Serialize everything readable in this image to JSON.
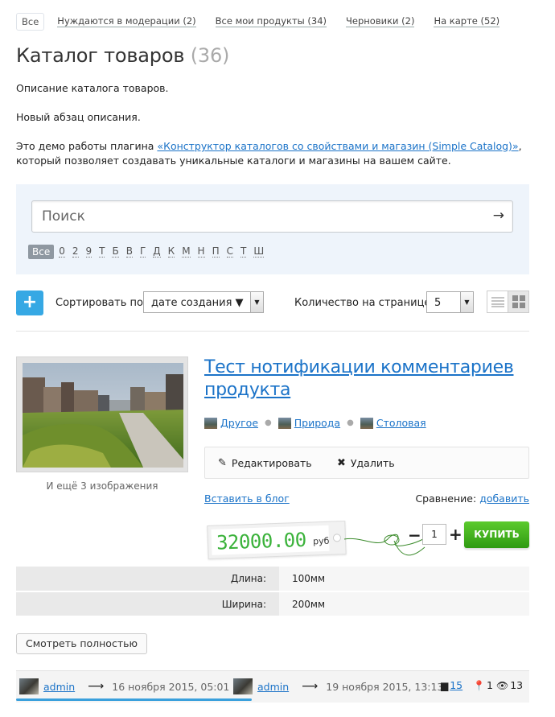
{
  "filters": {
    "all": "Все",
    "items": [
      "Нуждаются в модерации (2)",
      "Все мои продукты (34)",
      "Черновики (2)",
      "На карте (52)"
    ]
  },
  "catalog": {
    "title": "Каталог товаров",
    "count": "(36)",
    "desc1": "Описание каталога товаров.",
    "desc2": "Новый абзац описания.",
    "desc3_pre": "Это демо работы плагина ",
    "desc3_link": "«Конструктор каталогов со свойствами и магазин (Simple Catalog)»",
    "desc3_post": ",",
    "desc3_line2": "который позволяет создавать уникальные каталоги и магазины на вашем сайте."
  },
  "search": {
    "placeholder": "Поиск",
    "arrow": "→",
    "letters_active": "Все",
    "letters": [
      "0",
      "2",
      "9",
      "Т",
      "Б",
      "В",
      "Г",
      "Д",
      "К",
      "М",
      "Н",
      "П",
      "С",
      "Т",
      "Ш"
    ]
  },
  "toolbar": {
    "add": "+",
    "sort_label": "Сортировать по",
    "sort_value": "дате создания ▼",
    "per_page_label": "Количество на странице",
    "per_page_value": "5"
  },
  "product": {
    "title": "Тест нотификации комментариев продукта",
    "more_images": "И ещё 3 изображения",
    "categories": [
      "Другое",
      "Природа",
      "Столовая"
    ],
    "edit": "Редактировать",
    "delete": "Удалить",
    "insert_blog": "Вставить в блог",
    "compare_label": "Сравнение:",
    "compare_link": "добавить",
    "price": "32000.00",
    "currency": "руб",
    "qty": "1",
    "minus": "−",
    "plus": "+",
    "buy": "КУПИТЬ",
    "props": [
      {
        "key": "Длина:",
        "value": "100мм"
      },
      {
        "key": "Ширина:",
        "value": "200мм"
      }
    ],
    "view_full": "Смотреть полностью"
  },
  "footer": {
    "author1": "admin",
    "date1": "16 ноября 2015, 05:01",
    "author2": "admin",
    "date2": "19 ноября 2015, 13:13",
    "comments": "15",
    "places": "1",
    "views": "13",
    "progress_fraction": 0.46
  }
}
